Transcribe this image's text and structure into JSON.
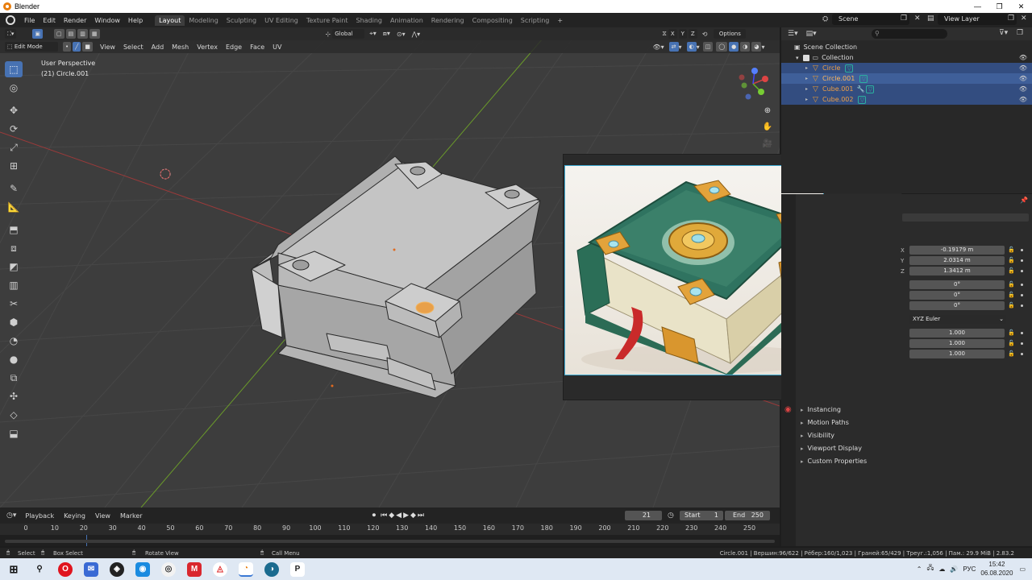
{
  "window": {
    "title": "Blender"
  },
  "topbar": {
    "menus": [
      "File",
      "Edit",
      "Render",
      "Window",
      "Help"
    ],
    "workspaces": [
      "Layout",
      "Modeling",
      "Sculpting",
      "UV Editing",
      "Texture Paint",
      "Shading",
      "Animation",
      "Rendering",
      "Compositing",
      "Scripting"
    ],
    "active_workspace": "Layout",
    "scene": "Scene",
    "view_layer": "View Layer"
  },
  "viewport": {
    "mode": "Edit Mode",
    "menus": [
      "View",
      "Select",
      "Add",
      "Mesh",
      "Vertex",
      "Edge",
      "Face",
      "UV"
    ],
    "transform_orientation": "Global",
    "options_label": "Options",
    "axes": [
      "X",
      "Y",
      "Z"
    ],
    "info_line1": "User Perspective",
    "info_line2": "(21) Circle.001",
    "accent": "#4772b3"
  },
  "outliner": {
    "search_placeholder": "",
    "root": "Scene Collection",
    "collection": "Collection",
    "objects": [
      {
        "name": "Circle",
        "selected": false
      },
      {
        "name": "Circle.001",
        "selected": true
      },
      {
        "name": "Cube.001",
        "selected": false
      },
      {
        "name": "Cube.002",
        "selected": false
      }
    ]
  },
  "properties": {
    "location": {
      "x": "-0.19179 m",
      "y": "2.0314 m",
      "z": "1.3412 m"
    },
    "rotation": {
      "x": "0°",
      "y": "0°",
      "z": "0°"
    },
    "rotation_mode": "XYZ Euler",
    "scale": {
      "x": "1.000",
      "y": "1.000",
      "z": "1.000"
    },
    "panels": [
      "Instancing",
      "Motion Paths",
      "Visibility",
      "Viewport Display",
      "Custom Properties"
    ]
  },
  "timeline": {
    "menus": [
      "Playback",
      "Keying",
      "View",
      "Marker"
    ],
    "current_frame": "21",
    "start_label": "Start",
    "start": "1",
    "end_label": "End",
    "end": "250",
    "ruler": [
      "0",
      "10",
      "20",
      "30",
      "40",
      "50",
      "60",
      "70",
      "80",
      "90",
      "100",
      "110",
      "120",
      "130",
      "140",
      "150",
      "160",
      "170",
      "180",
      "190",
      "200",
      "210",
      "220",
      "230",
      "240",
      "250"
    ]
  },
  "statusbar": {
    "select": "Select",
    "box_select": "Box Select",
    "rotate_view": "Rotate View",
    "call_menu": "Call Menu",
    "stats": "Circle.001 | Вершин:96/622 | Рёбер:160/1,023 | Граней:65/429 | Треуг.:1,056 | Пам.: 29.9 MiB | 2.83.2"
  },
  "taskbar": {
    "lang": "РУС",
    "time": "15:42",
    "date": "06.08.2020"
  }
}
